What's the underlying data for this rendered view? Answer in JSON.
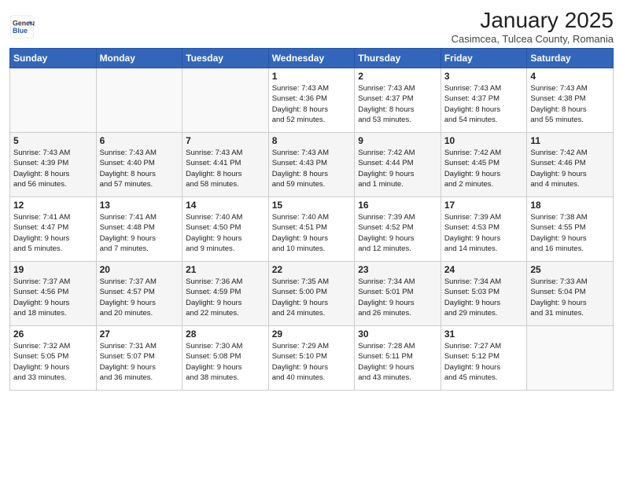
{
  "header": {
    "logo_general": "General",
    "logo_blue": "Blue",
    "month": "January 2025",
    "location": "Casimcea, Tulcea County, Romania"
  },
  "days_of_week": [
    "Sunday",
    "Monday",
    "Tuesday",
    "Wednesday",
    "Thursday",
    "Friday",
    "Saturday"
  ],
  "weeks": [
    [
      {
        "day": "",
        "details": ""
      },
      {
        "day": "",
        "details": ""
      },
      {
        "day": "",
        "details": ""
      },
      {
        "day": "1",
        "details": "Sunrise: 7:43 AM\nSunset: 4:36 PM\nDaylight: 8 hours\nand 52 minutes."
      },
      {
        "day": "2",
        "details": "Sunrise: 7:43 AM\nSunset: 4:37 PM\nDaylight: 8 hours\nand 53 minutes."
      },
      {
        "day": "3",
        "details": "Sunrise: 7:43 AM\nSunset: 4:37 PM\nDaylight: 8 hours\nand 54 minutes."
      },
      {
        "day": "4",
        "details": "Sunrise: 7:43 AM\nSunset: 4:38 PM\nDaylight: 8 hours\nand 55 minutes."
      }
    ],
    [
      {
        "day": "5",
        "details": "Sunrise: 7:43 AM\nSunset: 4:39 PM\nDaylight: 8 hours\nand 56 minutes."
      },
      {
        "day": "6",
        "details": "Sunrise: 7:43 AM\nSunset: 4:40 PM\nDaylight: 8 hours\nand 57 minutes."
      },
      {
        "day": "7",
        "details": "Sunrise: 7:43 AM\nSunset: 4:41 PM\nDaylight: 8 hours\nand 58 minutes."
      },
      {
        "day": "8",
        "details": "Sunrise: 7:43 AM\nSunset: 4:43 PM\nDaylight: 8 hours\nand 59 minutes."
      },
      {
        "day": "9",
        "details": "Sunrise: 7:42 AM\nSunset: 4:44 PM\nDaylight: 9 hours\nand 1 minute."
      },
      {
        "day": "10",
        "details": "Sunrise: 7:42 AM\nSunset: 4:45 PM\nDaylight: 9 hours\nand 2 minutes."
      },
      {
        "day": "11",
        "details": "Sunrise: 7:42 AM\nSunset: 4:46 PM\nDaylight: 9 hours\nand 4 minutes."
      }
    ],
    [
      {
        "day": "12",
        "details": "Sunrise: 7:41 AM\nSunset: 4:47 PM\nDaylight: 9 hours\nand 5 minutes."
      },
      {
        "day": "13",
        "details": "Sunrise: 7:41 AM\nSunset: 4:48 PM\nDaylight: 9 hours\nand 7 minutes."
      },
      {
        "day": "14",
        "details": "Sunrise: 7:40 AM\nSunset: 4:50 PM\nDaylight: 9 hours\nand 9 minutes."
      },
      {
        "day": "15",
        "details": "Sunrise: 7:40 AM\nSunset: 4:51 PM\nDaylight: 9 hours\nand 10 minutes."
      },
      {
        "day": "16",
        "details": "Sunrise: 7:39 AM\nSunset: 4:52 PM\nDaylight: 9 hours\nand 12 minutes."
      },
      {
        "day": "17",
        "details": "Sunrise: 7:39 AM\nSunset: 4:53 PM\nDaylight: 9 hours\nand 14 minutes."
      },
      {
        "day": "18",
        "details": "Sunrise: 7:38 AM\nSunset: 4:55 PM\nDaylight: 9 hours\nand 16 minutes."
      }
    ],
    [
      {
        "day": "19",
        "details": "Sunrise: 7:37 AM\nSunset: 4:56 PM\nDaylight: 9 hours\nand 18 minutes."
      },
      {
        "day": "20",
        "details": "Sunrise: 7:37 AM\nSunset: 4:57 PM\nDaylight: 9 hours\nand 20 minutes."
      },
      {
        "day": "21",
        "details": "Sunrise: 7:36 AM\nSunset: 4:59 PM\nDaylight: 9 hours\nand 22 minutes."
      },
      {
        "day": "22",
        "details": "Sunrise: 7:35 AM\nSunset: 5:00 PM\nDaylight: 9 hours\nand 24 minutes."
      },
      {
        "day": "23",
        "details": "Sunrise: 7:34 AM\nSunset: 5:01 PM\nDaylight: 9 hours\nand 26 minutes."
      },
      {
        "day": "24",
        "details": "Sunrise: 7:34 AM\nSunset: 5:03 PM\nDaylight: 9 hours\nand 29 minutes."
      },
      {
        "day": "25",
        "details": "Sunrise: 7:33 AM\nSunset: 5:04 PM\nDaylight: 9 hours\nand 31 minutes."
      }
    ],
    [
      {
        "day": "26",
        "details": "Sunrise: 7:32 AM\nSunset: 5:05 PM\nDaylight: 9 hours\nand 33 minutes."
      },
      {
        "day": "27",
        "details": "Sunrise: 7:31 AM\nSunset: 5:07 PM\nDaylight: 9 hours\nand 36 minutes."
      },
      {
        "day": "28",
        "details": "Sunrise: 7:30 AM\nSunset: 5:08 PM\nDaylight: 9 hours\nand 38 minutes."
      },
      {
        "day": "29",
        "details": "Sunrise: 7:29 AM\nSunset: 5:10 PM\nDaylight: 9 hours\nand 40 minutes."
      },
      {
        "day": "30",
        "details": "Sunrise: 7:28 AM\nSunset: 5:11 PM\nDaylight: 9 hours\nand 43 minutes."
      },
      {
        "day": "31",
        "details": "Sunrise: 7:27 AM\nSunset: 5:12 PM\nDaylight: 9 hours\nand 45 minutes."
      },
      {
        "day": "",
        "details": ""
      }
    ]
  ]
}
